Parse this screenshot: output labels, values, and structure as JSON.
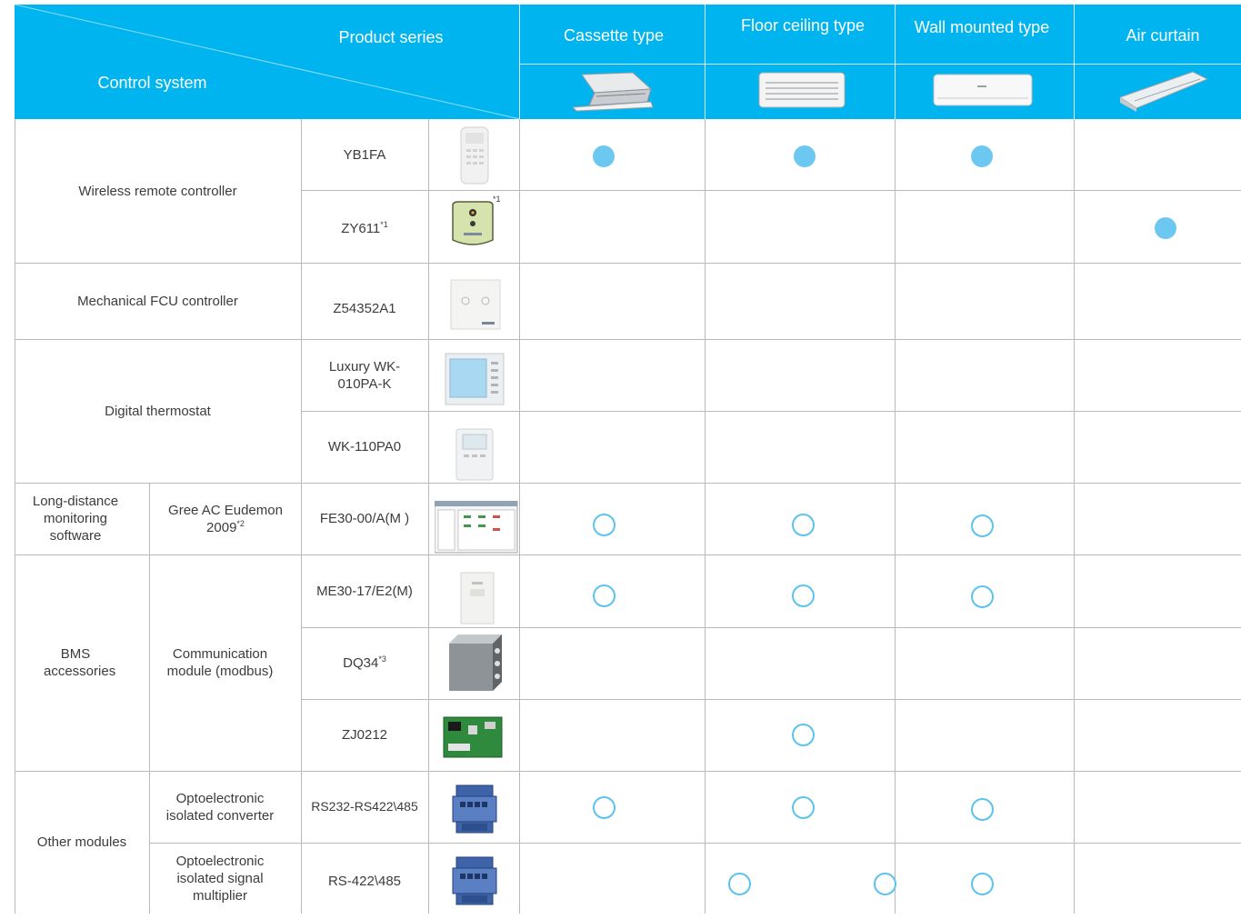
{
  "header": {
    "product_series": "Product series",
    "control_system": "Control system",
    "columns": [
      "Cassette type",
      "Floor ceiling type",
      "Wall mounted type",
      "Air curtain"
    ]
  },
  "categories": {
    "wireless": "Wireless remote controller",
    "mechanical": "Mechanical FCU controller",
    "digital": "Digital thermostat",
    "long_distance": "Long-distance monitoring software",
    "gree_eudemon": "Gree AC Eudemon 2009",
    "gree_eudemon_note": "*2",
    "bms": "BMS accessories",
    "comm_module": "Communication module (modbus)",
    "other": "Other modules",
    "opto_converter": "Optoelectronic isolated converter",
    "opto_multiplier": "Optoelectronic isolated signal multiplier"
  },
  "models": {
    "yb1fa": "YB1FA",
    "zy611": "ZY611",
    "zy611_note": "*1",
    "zy611_img_note": "*1",
    "z54352a1": "Z54352A1",
    "luxury": "Luxury WK-010PA-K",
    "wk110": "WK-110PA0",
    "fe30": "FE30-00/A(M )",
    "me30": "ME30-17/E2(M)",
    "dq34": "DQ34",
    "dq34_note": "*3",
    "zj0212": "ZJ0212",
    "rs232": "RS232-RS422\\485",
    "rs422": "RS-422\\485"
  },
  "marks": {
    "filled": "supported",
    "outline": "optional"
  },
  "colors": {
    "header_bg": "#00b4ef",
    "dot_filled": "#6cc8f0",
    "dot_outline": "#5cc2ee",
    "grid": "#b9b9b9"
  }
}
